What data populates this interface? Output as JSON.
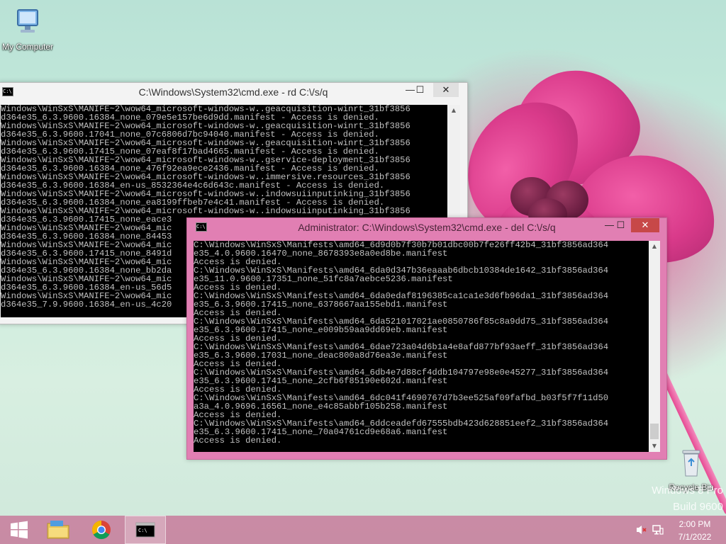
{
  "desktop": {
    "icons": [
      {
        "label": "My Computer"
      },
      {
        "label": "Recycle Bin"
      }
    ],
    "watermark": {
      "line1": "Windows 8 Pro",
      "line2": "Build 9600"
    }
  },
  "window_back": {
    "title": "C:\\Windows\\System32\\cmd.exe - rd  C:\\/s/q",
    "controls": {
      "minimize": "—",
      "maximize": "☐",
      "close": "✕"
    },
    "lines": [
      "Windows\\WinSxS\\MANIFE~2\\wow64_microsoft-windows-w..geacquisition-winrt_31bf3856",
      "d364e35_6.3.9600.16384_none_079e5e157be6d9dd.manifest - Access is denied.",
      "Windows\\WinSxS\\MANIFE~2\\wow64_microsoft-windows-w..geacquisition-winrt_31bf3856",
      "d364e35_6.3.9600.17041_none_07c6806d7bc94040.manifest - Access is denied.",
      "Windows\\WinSxS\\MANIFE~2\\wow64_microsoft-windows-w..geacquisition-winrt_31bf3856",
      "d364e35_6.3.9600.17415_none_07eaf8f17bad4665.manifest - Access is denied.",
      "Windows\\WinSxS\\MANIFE~2\\wow64_microsoft-windows-w..gservice-deployment_31bf3856",
      "d364e35_6.3.9600.16384_none_476f92ea9ece2436.manifest - Access is denied.",
      "Windows\\WinSxS\\MANIFE~2\\wow64_microsoft-windows-w..immersive.resources_31bf3856",
      "d364e35_6.3.9600.16384_en-us_8532364e4c6d643c.manifest - Access is denied.",
      "Windows\\WinSxS\\MANIFE~2\\wow64_microsoft-windows-w..indowsuiinputinking_31bf3856",
      "d364e35_6.3.9600.16384_none_ea8199ffbeb7e4c41.manifest - Access is denied.",
      "Windows\\WinSxS\\MANIFE~2\\wow64_microsoft-windows-w..indowsuiinputinking_31bf3856",
      "d364e35_6.3.9600.17415_none_eace3",
      "Windows\\WinSxS\\MANIFE~2\\wow64_mic",
      "d364e35_6.3.9600.16384_none_84453",
      "Windows\\WinSxS\\MANIFE~2\\wow64_mic",
      "d364e35_6.3.9600.17415_none_8491d",
      "Windows\\WinSxS\\MANIFE~2\\wow64_mic",
      "d364e35_6.3.9600.16384_none_bb2da",
      "Windows\\WinSxS\\MANIFE~2\\wow64_mic",
      "d364e35_6.3.9600.16384_en-us_56d5",
      "Windows\\WinSxS\\MANIFE~2\\wow64_mic",
      "d364e35_7.9.9600.16384_en-us_4c20"
    ]
  },
  "window_front": {
    "title": "Administrator: C:\\Windows\\System32\\cmd.exe - del  C:\\/s/q",
    "controls": {
      "minimize": "—",
      "maximize": "☐",
      "close": "✕"
    },
    "lines": [
      "C:\\Windows\\WinSxS\\Manifests\\amd64_6d9d0b7f30b7b01dbc00b7fe26ff42b4_31bf3856ad364",
      "e35_4.0.9600.16470_none_8678393e8a0ed8be.manifest",
      "Access is denied.",
      "C:\\Windows\\WinSxS\\Manifests\\amd64_6da0d347b36eaaab6dbcb10384de1642_31bf3856ad364",
      "e35_11.0.9600.17351_none_51fc8a7aebce5236.manifest",
      "Access is denied.",
      "C:\\Windows\\WinSxS\\Manifests\\amd64_6da0edaf8196385ca1ca1e3d6fb96da1_31bf3856ad364",
      "e35_6.3.9600.17415_none_6378667aa155ebd1.manifest",
      "Access is denied.",
      "C:\\Windows\\WinSxS\\Manifests\\amd64_6da521017021ae0850786f85c8a9dd75_31bf3856ad364",
      "e35_6.3.9600.17415_none_e009b59aa9dd69eb.manifest",
      "Access is denied.",
      "C:\\Windows\\WinSxS\\Manifests\\amd64_6dae723a04d6b1a4e8afd877bf93aeff_31bf3856ad364",
      "e35_6.3.9600.17031_none_deac800a8d76ea3e.manifest",
      "Access is denied.",
      "C:\\Windows\\WinSxS\\Manifests\\amd64_6db4e7d88cf4ddb104797e98e0e45277_31bf3856ad364",
      "e35_6.3.9600.17415_none_2cfb6f85190e602d.manifest",
      "Access is denied.",
      "C:\\Windows\\WinSxS\\Manifests\\amd64_6dc041f4690767d7b3ee525af09fafbd_b03f5f7f11d50",
      "a3a_4.0.9696.16561_none_e4c85abbf105b258.manifest",
      "Access is denied.",
      "C:\\Windows\\WinSxS\\Manifests\\amd64_6ddceadefd67555bdb423d628851eef2_31bf3856ad364",
      "e35_6.3.9600.17415_none_70a04761cd9e68a6.manifest",
      "Access is denied."
    ]
  },
  "taskbar": {
    "time": "2:00 PM",
    "date": "7/1/2022",
    "icons": [
      "windows-start-icon",
      "file-explorer-icon",
      "chrome-icon",
      "cmd-icon"
    ]
  },
  "colors": {
    "accent_pink": "#c882a0",
    "console_bg": "#000000",
    "console_fg": "#c0c0c0",
    "close_red": "#c74848"
  }
}
